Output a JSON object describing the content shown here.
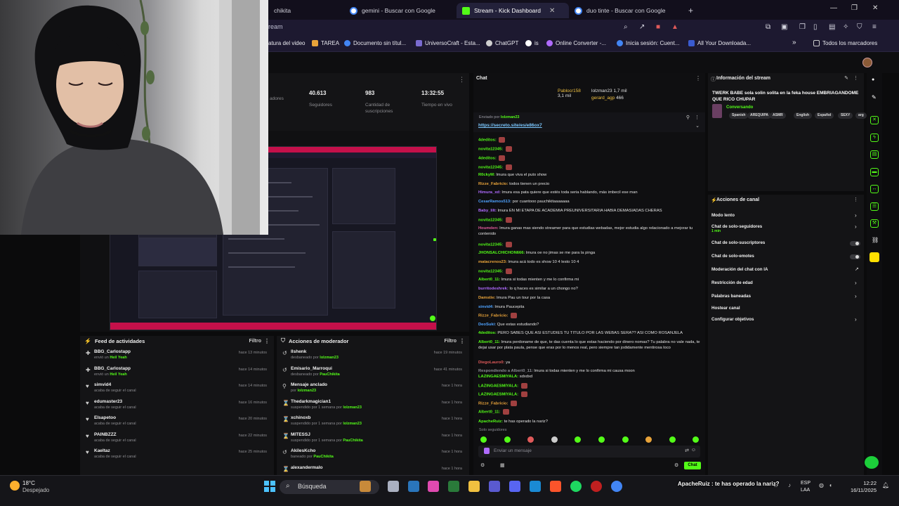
{
  "browser": {
    "tabs": [
      {
        "label": "chikita",
        "active": false
      },
      {
        "label": "gemini - Buscar con Google",
        "active": false
      },
      {
        "label": "Stream - Kick Dashboard",
        "active": true
      },
      {
        "label": "duo tinte - Buscar con Google",
        "active": false
      }
    ],
    "new_tab": "+",
    "url_fragment": "ream",
    "bookmarks": [
      "atura del video",
      "TAREA",
      "Documento sin títul...",
      "UniversoCraft - Esta...",
      "ChatGPT",
      "is",
      "Online Converter -...",
      "Inicia sesión: Cuent...",
      "All Your Downloada..."
    ],
    "bookmarks_overflow": "»",
    "all_bookmarks": "Todos los marcadores",
    "window_controls": [
      "—",
      "❐",
      "✕"
    ]
  },
  "stats": {
    "items": [
      {
        "value": "",
        "label": "adores"
      },
      {
        "value": "40.613",
        "label": "Seguidores"
      },
      {
        "value": "983",
        "label": "Cantidad de suscripciones"
      },
      {
        "value": "13:32:55",
        "label": "Tiempo en vivo"
      }
    ]
  },
  "activity_feed": {
    "title": "Feed de actividades",
    "filter": "Filtro",
    "items": [
      {
        "icon": "gift-icon",
        "name": "BBG_Carlostapp",
        "sub_pre": "envió un",
        "sub_hl": "Heil Yeah",
        "time": "hace 13 minutos"
      },
      {
        "icon": "gift-icon",
        "name": "BBG_Carlostapp",
        "sub_pre": "envió un",
        "sub_hl": "Heil Yeah",
        "time": "hace 14 minutos"
      },
      {
        "icon": "heart-icon",
        "name": "simvid4",
        "sub_pre": "acaba de seguir el canal",
        "sub_hl": "",
        "time": "hace 14 minutos"
      },
      {
        "icon": "heart-icon",
        "name": "edumaster23",
        "sub_pre": "acaba de seguir el canal",
        "sub_hl": "",
        "time": "hace 16 minutos"
      },
      {
        "icon": "heart-icon",
        "name": "Elsapetoo",
        "sub_pre": "acaba de seguir el canal",
        "sub_hl": "",
        "time": "hace 20 minutos"
      },
      {
        "icon": "heart-icon",
        "name": "PAINBZZZ",
        "sub_pre": "acaba de seguir el canal",
        "sub_hl": "",
        "time": "hace 22 minutos"
      },
      {
        "icon": "heart-icon",
        "name": "Kaeltaz",
        "sub_pre": "acaba de seguir el canal",
        "sub_hl": "",
        "time": "hace 25 minutos"
      }
    ]
  },
  "mod_actions": {
    "title": "Acciones de moderador",
    "filter": "Filtro",
    "items": [
      {
        "icon": "undo-icon",
        "name": "Ilshenk",
        "sub_pre": "desbaneado por",
        "sub_hl": "lolzman23",
        "time": "hace 19 minutos"
      },
      {
        "icon": "undo-icon",
        "name": "Emisario_Marroqui",
        "sub_pre": "desbaneado por",
        "sub_hl": "PauChikita",
        "time": "hace 41 minutos"
      },
      {
        "icon": "pin-icon",
        "name": "Mensaje anclado",
        "sub_pre": "por",
        "sub_hl": "lolzman23",
        "time": "hace 1 hora"
      },
      {
        "icon": "hourglass-icon",
        "name": "Thedarkmagician1",
        "sub_pre": "suspendido por 1 semana por",
        "sub_hl": "lolzman23",
        "time": "hace 1 hora"
      },
      {
        "icon": "hourglass-icon",
        "name": "xchinoxb",
        "sub_pre": "suspendido por 1 semana por",
        "sub_hl": "lolzman23",
        "time": "hace 1 hora"
      },
      {
        "icon": "hourglass-icon",
        "name": "MITESSJ",
        "sub_pre": "suspendido por 1 semana por",
        "sub_hl": "PauChikita",
        "time": "hace 1 hora"
      },
      {
        "icon": "undo-icon",
        "name": "AkilesKcho",
        "sub_pre": "baneado por",
        "sub_hl": "PauChikita",
        "time": "hace 1 hora"
      },
      {
        "icon": "hourglass-icon",
        "name": "alexandermalo",
        "sub_pre": "",
        "sub_hl": "",
        "time": "hace 1 hora"
      }
    ]
  },
  "chat": {
    "title": "Chat",
    "top_gifters": [
      {
        "name": "Pablocr158",
        "amount": "3,1 mil"
      },
      {
        "name": "lolzman23",
        "amount": "1,7 mil"
      },
      {
        "name": "gerard_agp",
        "amount": "466"
      }
    ],
    "pinned_by_label": "Enviado por",
    "pinned_by": "lolzman23",
    "pinned_link": "https://secreto.site/es/e86ox7",
    "messages": [
      {
        "user": "4deditos:",
        "color": "#53fc18",
        "text": ""
      },
      {
        "user": "novita12345:",
        "color": "#53fc18",
        "text": ""
      },
      {
        "user": "4deditos:",
        "color": "#53fc18",
        "text": ""
      },
      {
        "user": "novita12345:",
        "color": "#53fc18",
        "text": ""
      },
      {
        "user": "R0ckyM:",
        "color": "#53fc18",
        "text": "lmura que viva el puto show"
      },
      {
        "user": "Rizze_Fabricio:",
        "color": "#e8a33a",
        "text": "todos tienen un precio"
      },
      {
        "user": "Himura_xd:",
        "color": "#b06bff",
        "text": "lmura esa pata quiere que estés toda seria hablando, más imbecil ese man"
      },
      {
        "user": "CesarRamos513:",
        "color": "#4fa3ff",
        "text": "por cuantooo pauchikitaaaaaaa"
      },
      {
        "user": "Baby_lilt:",
        "color": "#b06bff",
        "text": "lmura EN MI ETAPA DE ACADEMIA PREUNIVERSITARIA HABIA DEMASIADAS CHERAS"
      },
      {
        "user": "novita12345:",
        "color": "#53fc18",
        "text": ""
      },
      {
        "user": "Houmden:",
        "color": "#e05a9a",
        "text": "lmura ganas mas siendo streamer para que estudias webadas, mejor estudia algo relacionado a mejorar tu contenido"
      },
      {
        "user": "novita12345:",
        "color": "#53fc18",
        "text": ""
      },
      {
        "user": "JHONSALCHICHON666:",
        "color": "#53fc18",
        "text": "lmura oe no jimas  se me para la pinga"
      },
      {
        "user": "matacrenos23:",
        "color": "#e8a33a",
        "text": "lmura acá todo es show 10 4 lesto 10 4"
      },
      {
        "user": "novita12345:",
        "color": "#53fc18",
        "text": ""
      },
      {
        "user": "Albert0_11:",
        "color": "#53fc18",
        "text": "lmura si todas mienten y me lo confirma mi"
      },
      {
        "user": "burritodeshrek:",
        "color": "#b06bff",
        "text": "lo q haces es similar a un chongo no?"
      },
      {
        "user": "Damstie:",
        "color": "#e8a33a",
        "text": "lmura Pau un tour por la casa"
      },
      {
        "user": "sinvid4:",
        "color": "#4fa3ff",
        "text": "lmura Paucepita"
      },
      {
        "user": "Rizze_Fabricio:",
        "color": "#e8a33a",
        "text": ""
      },
      {
        "user": "DeoSuki:",
        "color": "#4fa3ff",
        "text": "Que estas estudiando?"
      },
      {
        "user": "4deditos:",
        "color": "#53fc18",
        "text": "PERO SABES QUE ASI ESTUDIES TU TITULO POR LAS WEBAS SERA?? ASI COMO ROSANJELA"
      },
      {
        "user": "Albert0_11:",
        "color": "#53fc18",
        "text": "lmura perdoname de que, te das cuenta lo que estas haciendo por dinero nomas? Tu palabra no vale nada, te dejai usar por plata paula, pense que eras por lo menos real, pero siempre tan jodidamente mentirosa loco"
      },
      {
        "user": "DiegoLauro0:",
        "color": "#e05a5a",
        "text": "ya"
      },
      {
        "user": "Respondiendo a Albert0_11:",
        "color": "#8c8c94",
        "text": "lmura si todas mienten y me lo confirma mi causa moon"
      },
      {
        "user": "LAZINGAESMIYALA:",
        "color": "#53fc18",
        "text": "sdxdxd"
      },
      {
        "user": "LAZINGAESMIYALA:",
        "color": "#53fc18",
        "text": ""
      },
      {
        "user": "LAZINGAESMIYALA:",
        "color": "#53fc18",
        "text": ""
      },
      {
        "user": "Rizze_Fabricio:",
        "color": "#e8a33a",
        "text": ""
      },
      {
        "user": "Albert0_11:",
        "color": "#53fc18",
        "text": ""
      },
      {
        "user": "ApacheRuiz:",
        "color": "#53fc18",
        "text": "te has operado la nariz?"
      }
    ],
    "only_followers": "Solo seguidores",
    "input_placeholder": "Enviar un mensaje",
    "send_label": "Chat"
  },
  "stream_info": {
    "title": "Información del stream",
    "stream_title": "TWERK BABE sola solin solita en la feka house EMBRIAGANDOME QUE RICO CHUPAR",
    "category": "Conversando",
    "tags": [
      "Spanish",
      "AREQUIPA",
      "ASMR",
      "English",
      "Español",
      "SEXY",
      "arg"
    ]
  },
  "channel_actions": {
    "title": "Acciones de canal",
    "items": [
      {
        "label": "Modo lento",
        "sub": "",
        "control": "chevron"
      },
      {
        "label": "Chat de solo-seguidores",
        "sub": "1 min",
        "control": "chevron"
      },
      {
        "label": "Chat de solo-suscriptores",
        "sub": "",
        "control": "toggle"
      },
      {
        "label": "Chat de solo-emotes",
        "sub": "",
        "control": "toggle"
      },
      {
        "label": "Moderación del chat con IA",
        "sub": "",
        "control": "external"
      },
      {
        "label": "Restricción de edad",
        "sub": "",
        "control": "chevron"
      },
      {
        "label": "Palabras baneadas",
        "sub": "",
        "control": "chevron"
      },
      {
        "label": "Hostear canal",
        "sub": "",
        "control": "none"
      },
      {
        "label": "Configurar objetivos",
        "sub": "",
        "control": "chevron"
      }
    ]
  },
  "taskbar": {
    "temp": "18°C",
    "weather": "Despejado",
    "search": "Búsqueda",
    "lang1": "ESP",
    "lang2": "LAA",
    "time": "12:22",
    "date": "16/11/2025",
    "overlay_text": "ApacheRuiz : te has operado la nariz?"
  },
  "colors": {
    "kick_green": "#53fc18",
    "kick_bg": "#0b0b0c",
    "browser_bg": "#1d1930"
  }
}
